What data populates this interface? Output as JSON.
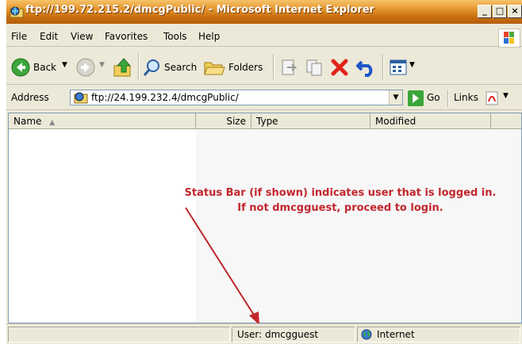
{
  "window": {
    "title": "ftp://199.72.215.2/dmcgPublic/ - Microsoft Internet Explorer"
  },
  "menu": [
    "File",
    "Edit",
    "View",
    "Favorites",
    "Tools",
    "Help"
  ],
  "toolbar": {
    "back_label": "Back",
    "search_label": "Search",
    "folders_label": "Folders"
  },
  "address": {
    "label": "Address",
    "url": "ftp://24.199.232.4/dmcgPublic/",
    "go_label": "Go",
    "links_label": "Links"
  },
  "columns": [
    "Name",
    "Size",
    "Type",
    "Modified"
  ],
  "annotation": {
    "line1": "Status Bar (if shown) indicates user that is logged in.",
    "line2": "If not dmcgguest, proceed to login.",
    "color": "#c1272d"
  },
  "status": {
    "user": "User: dmcgguest",
    "zone": "Internet"
  }
}
